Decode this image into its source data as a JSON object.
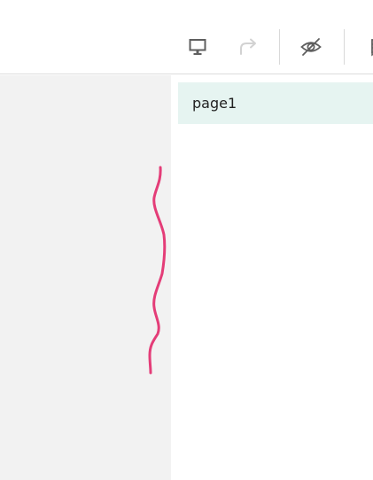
{
  "toolbar": {
    "icons": [
      {
        "name": "presentation-icon"
      },
      {
        "name": "redo-icon",
        "disabled": true
      },
      {
        "name": "eye-off-icon"
      },
      {
        "name": "pages-icon"
      }
    ]
  },
  "pages_panel": {
    "items": [
      {
        "label": "page1"
      }
    ],
    "selected_bg": "#e6f4f1"
  },
  "canvas": {
    "background": "#f2f2f2",
    "stroke_color": "#e43d78"
  }
}
